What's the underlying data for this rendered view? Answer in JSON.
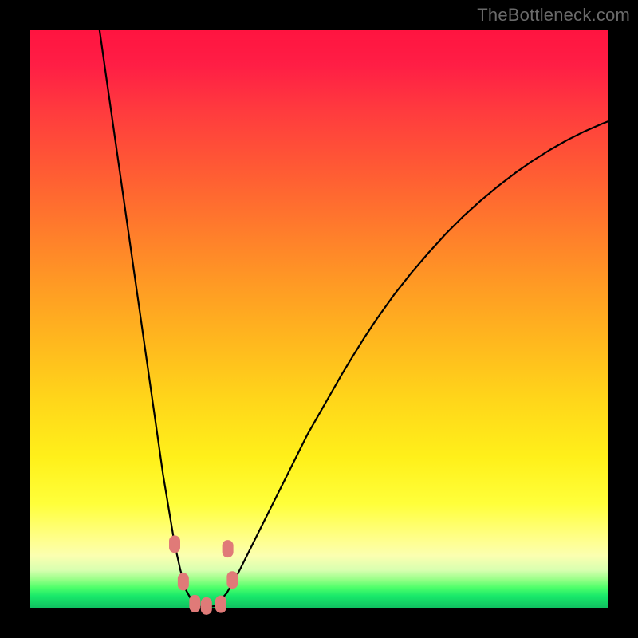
{
  "watermark": "TheBottleneck.com",
  "colors": {
    "frame": "#000000",
    "curve": "#000000",
    "marker": "#e07a78",
    "gradient_top": "#ff1440",
    "gradient_bottom": "#10c060"
  },
  "chart_data": {
    "type": "line",
    "title": "",
    "xlabel": "",
    "ylabel": "",
    "xlim": [
      0,
      100
    ],
    "ylim": [
      0,
      100
    ],
    "x": [
      12,
      13,
      14,
      15,
      16,
      17,
      18,
      19,
      20,
      21,
      22,
      23,
      24,
      25,
      26,
      27,
      28,
      29,
      30,
      32,
      34,
      36,
      38,
      40,
      42,
      44,
      46,
      48,
      50,
      52,
      54,
      56,
      58,
      60,
      63,
      66,
      69,
      72,
      75,
      78,
      81,
      84,
      87,
      90,
      93,
      96,
      99,
      100
    ],
    "y": [
      100,
      93,
      86,
      79,
      72,
      65,
      58,
      51,
      44,
      37,
      30,
      23,
      17,
      11,
      6.5,
      3.0,
      1.2,
      0.3,
      0.0,
      0.3,
      2.5,
      6.0,
      10.0,
      14.0,
      18.0,
      22.0,
      26.0,
      30.0,
      33.5,
      37.0,
      40.5,
      43.8,
      47.0,
      50.0,
      54.2,
      58.0,
      61.5,
      64.8,
      67.8,
      70.5,
      73.0,
      75.3,
      77.4,
      79.3,
      81.0,
      82.5,
      83.8,
      84.2
    ],
    "markers": [
      {
        "x": 25.0,
        "y": 11.0
      },
      {
        "x": 26.5,
        "y": 4.5
      },
      {
        "x": 28.5,
        "y": 0.7
      },
      {
        "x": 30.5,
        "y": 0.3
      },
      {
        "x": 33.0,
        "y": 0.6
      },
      {
        "x": 35.0,
        "y": 4.8
      },
      {
        "x": 34.2,
        "y": 10.2
      }
    ]
  }
}
